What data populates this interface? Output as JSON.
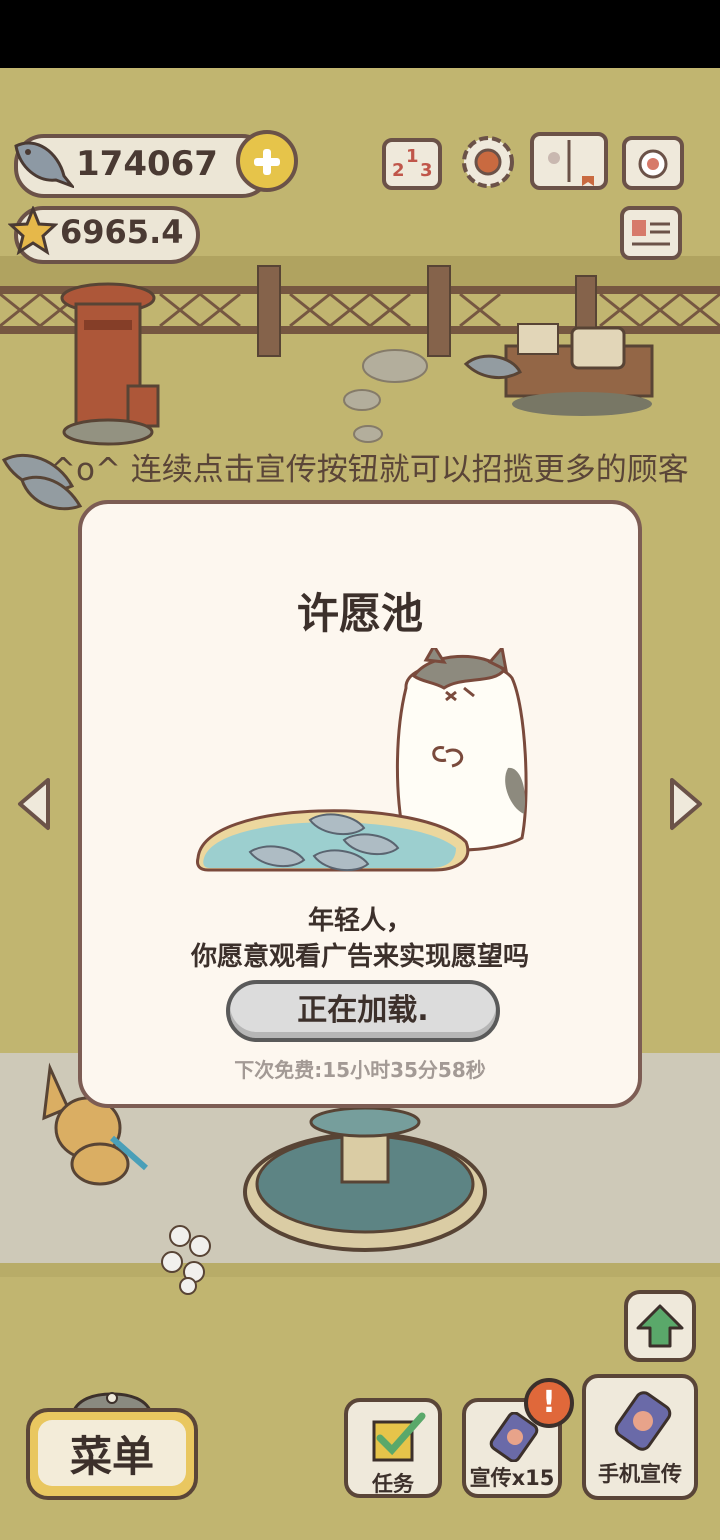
{
  "hud": {
    "fish_count": "174067",
    "star_rating": "6965.4"
  },
  "hint_text": "^o^ 连续点击宣传按钮就可以招揽更多的顾客",
  "dialog": {
    "title": "许愿池",
    "question_line1": "年轻人，",
    "question_line2": "你愿意观看广告来实现愿望吗",
    "loading_button": "正在加载.",
    "next_free": "下次免费:15小时35分58秒"
  },
  "bottom_bar": {
    "menu_label": "菜单",
    "tasks_label": "任务",
    "promo_label": "宣传x15",
    "phone_promo_label": "手机宣传",
    "badge": "!"
  },
  "colors": {
    "grass": "#cbbf78",
    "dialog_bg": "#fdf7ef",
    "outline": "#6b5248",
    "gold": "#e6c44a",
    "badge": "#e0683a"
  }
}
